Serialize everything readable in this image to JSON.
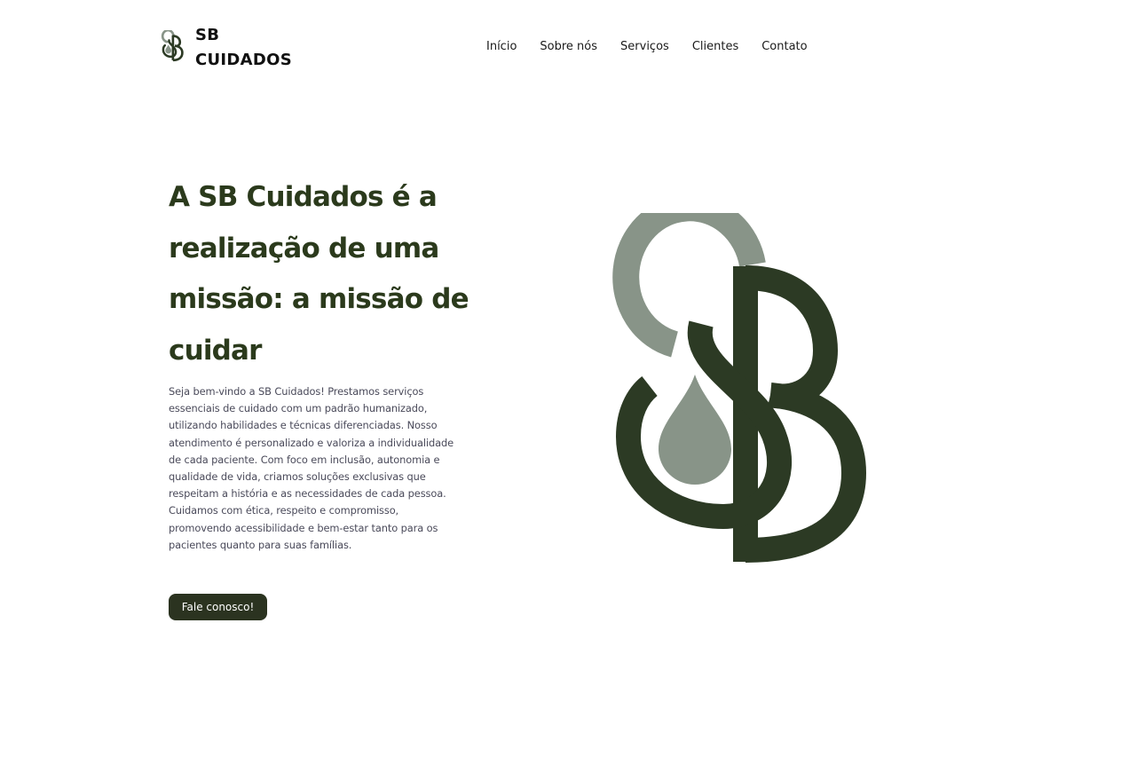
{
  "brand": {
    "line1": "SB",
    "line2": "CUIDADOS",
    "logo_icon": "sb-monogram-drop-icon"
  },
  "nav": {
    "items": [
      {
        "label": "Início"
      },
      {
        "label": "Sobre nós"
      },
      {
        "label": "Serviços"
      },
      {
        "label": "Clientes"
      },
      {
        "label": "Contato"
      }
    ]
  },
  "hero": {
    "title": "A SB Cuidados é a realização de uma missão: a missão de cuidar",
    "body": "Seja bem-vindo a SB Cuidados! Prestamos serviços essenciais de cuidado com um padrão humanizado, utilizando habilidades e técnicas diferenciadas. Nosso atendimento é personalizado e valoriza a individualidade de cada paciente. Com foco em inclusão, autonomia e qualidade de vida, criamos soluções exclusivas que respeitam a história e as necessidades de cada pessoa. Cuidamos com ética, respeito e compromisso, promovendo acessibilidade e bem-estar tanto para os pacientes quanto para suas famílias.",
    "cta_label": "Fale conosco!"
  },
  "colors": {
    "dark_green": "#2b3a1c",
    "logo_dark": "#2c3a24",
    "logo_sage": "#889488",
    "button_bg": "#2b3320"
  }
}
